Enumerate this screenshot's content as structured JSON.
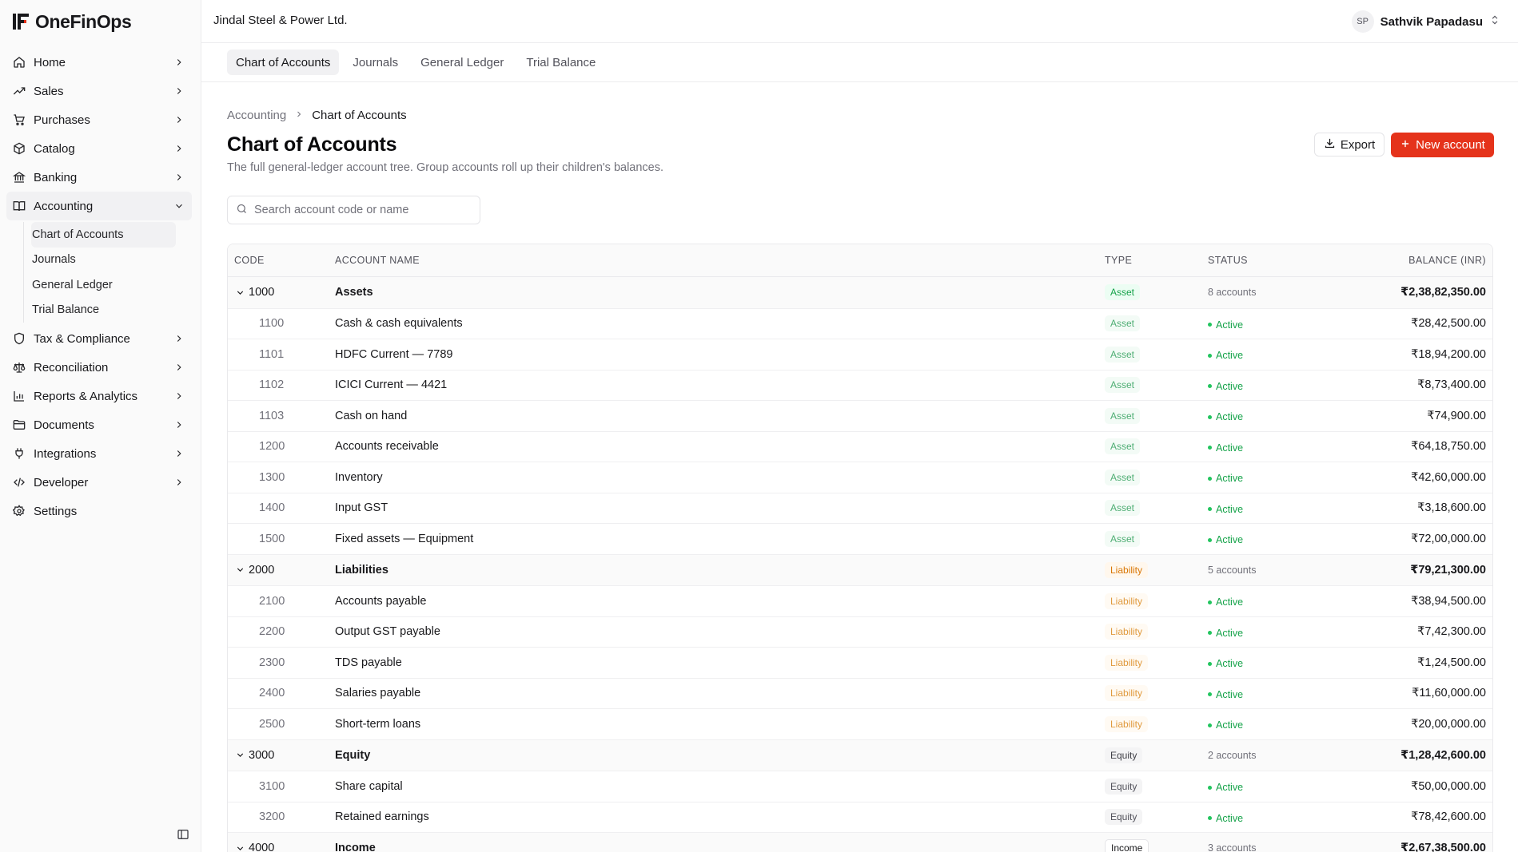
{
  "app": {
    "name": "OneFinOps"
  },
  "company": "Jindal Steel & Power Ltd.",
  "user": {
    "initials": "SP",
    "name": "Sathvik Papadasu"
  },
  "sidebar": {
    "items": [
      {
        "label": "Home",
        "icon": "home-icon"
      },
      {
        "label": "Sales",
        "icon": "trending-up-icon"
      },
      {
        "label": "Purchases",
        "icon": "cart-icon"
      },
      {
        "label": "Catalog",
        "icon": "package-icon"
      },
      {
        "label": "Banking",
        "icon": "bank-icon"
      },
      {
        "label": "Accounting",
        "icon": "book-icon",
        "expanded": true
      },
      {
        "label": "Tax & Compliance",
        "icon": "shield-icon"
      },
      {
        "label": "Reconciliation",
        "icon": "scale-icon"
      },
      {
        "label": "Reports & Analytics",
        "icon": "bar-chart-icon"
      },
      {
        "label": "Documents",
        "icon": "folder-icon"
      },
      {
        "label": "Integrations",
        "icon": "plug-icon"
      },
      {
        "label": "Developer",
        "icon": "code-icon"
      },
      {
        "label": "Settings",
        "icon": "gear-icon"
      }
    ],
    "accounting_sub": [
      "Chart of Accounts",
      "Journals",
      "General Ledger",
      "Trial Balance"
    ]
  },
  "tabs": [
    "Chart of Accounts",
    "Journals",
    "General Ledger",
    "Trial Balance"
  ],
  "breadcrumb": {
    "parent": "Accounting",
    "current": "Chart of Accounts"
  },
  "page": {
    "title": "Chart of Accounts",
    "subtitle": "The full general-ledger account tree. Group accounts roll up their children's balances.",
    "export_label": "Export",
    "new_label": "New account"
  },
  "search": {
    "placeholder": "Search account code or name"
  },
  "table": {
    "columns": [
      "CODE",
      "ACCOUNT NAME",
      "TYPE",
      "STATUS",
      "BALANCE (INR)"
    ],
    "rows": [
      {
        "group": true,
        "code": "1000",
        "name": "Assets",
        "type": "Asset",
        "status": "8 accounts",
        "balance": "₹2,38,82,350.00"
      },
      {
        "code": "1100",
        "name": "Cash & cash equivalents",
        "type": "Asset",
        "status": "Active",
        "balance": "₹28,42,500.00"
      },
      {
        "code": "1101",
        "name": "HDFC Current — 7789",
        "type": "Asset",
        "status": "Active",
        "balance": "₹18,94,200.00"
      },
      {
        "code": "1102",
        "name": "ICICI Current — 4421",
        "type": "Asset",
        "status": "Active",
        "balance": "₹8,73,400.00"
      },
      {
        "code": "1103",
        "name": "Cash on hand",
        "type": "Asset",
        "status": "Active",
        "balance": "₹74,900.00"
      },
      {
        "code": "1200",
        "name": "Accounts receivable",
        "type": "Asset",
        "status": "Active",
        "balance": "₹64,18,750.00"
      },
      {
        "code": "1300",
        "name": "Inventory",
        "type": "Asset",
        "status": "Active",
        "balance": "₹42,60,000.00"
      },
      {
        "code": "1400",
        "name": "Input GST",
        "type": "Asset",
        "status": "Active",
        "balance": "₹3,18,600.00"
      },
      {
        "code": "1500",
        "name": "Fixed assets — Equipment",
        "type": "Asset",
        "status": "Active",
        "balance": "₹72,00,000.00"
      },
      {
        "group": true,
        "code": "2000",
        "name": "Liabilities",
        "type": "Liability",
        "status": "5 accounts",
        "balance": "₹79,21,300.00"
      },
      {
        "code": "2100",
        "name": "Accounts payable",
        "type": "Liability",
        "status": "Active",
        "balance": "₹38,94,500.00"
      },
      {
        "code": "2200",
        "name": "Output GST payable",
        "type": "Liability",
        "status": "Active",
        "balance": "₹7,42,300.00"
      },
      {
        "code": "2300",
        "name": "TDS payable",
        "type": "Liability",
        "status": "Active",
        "balance": "₹1,24,500.00"
      },
      {
        "code": "2400",
        "name": "Salaries payable",
        "type": "Liability",
        "status": "Active",
        "balance": "₹11,60,000.00"
      },
      {
        "code": "2500",
        "name": "Short-term loans",
        "type": "Liability",
        "status": "Active",
        "balance": "₹20,00,000.00"
      },
      {
        "group": true,
        "code": "3000",
        "name": "Equity",
        "type": "Equity",
        "status": "2 accounts",
        "balance": "₹1,28,42,600.00"
      },
      {
        "code": "3100",
        "name": "Share capital",
        "type": "Equity",
        "status": "Active",
        "balance": "₹50,00,000.00"
      },
      {
        "code": "3200",
        "name": "Retained earnings",
        "type": "Equity",
        "status": "Active",
        "balance": "₹78,42,600.00"
      },
      {
        "group": true,
        "code": "4000",
        "name": "Income",
        "type": "Income",
        "status": "3 accounts",
        "balance": "₹2,67,38,500.00"
      }
    ]
  },
  "colors": {
    "accent": "#e5331b",
    "active_green": "#16a34a",
    "liability_amber": "#d97706"
  }
}
